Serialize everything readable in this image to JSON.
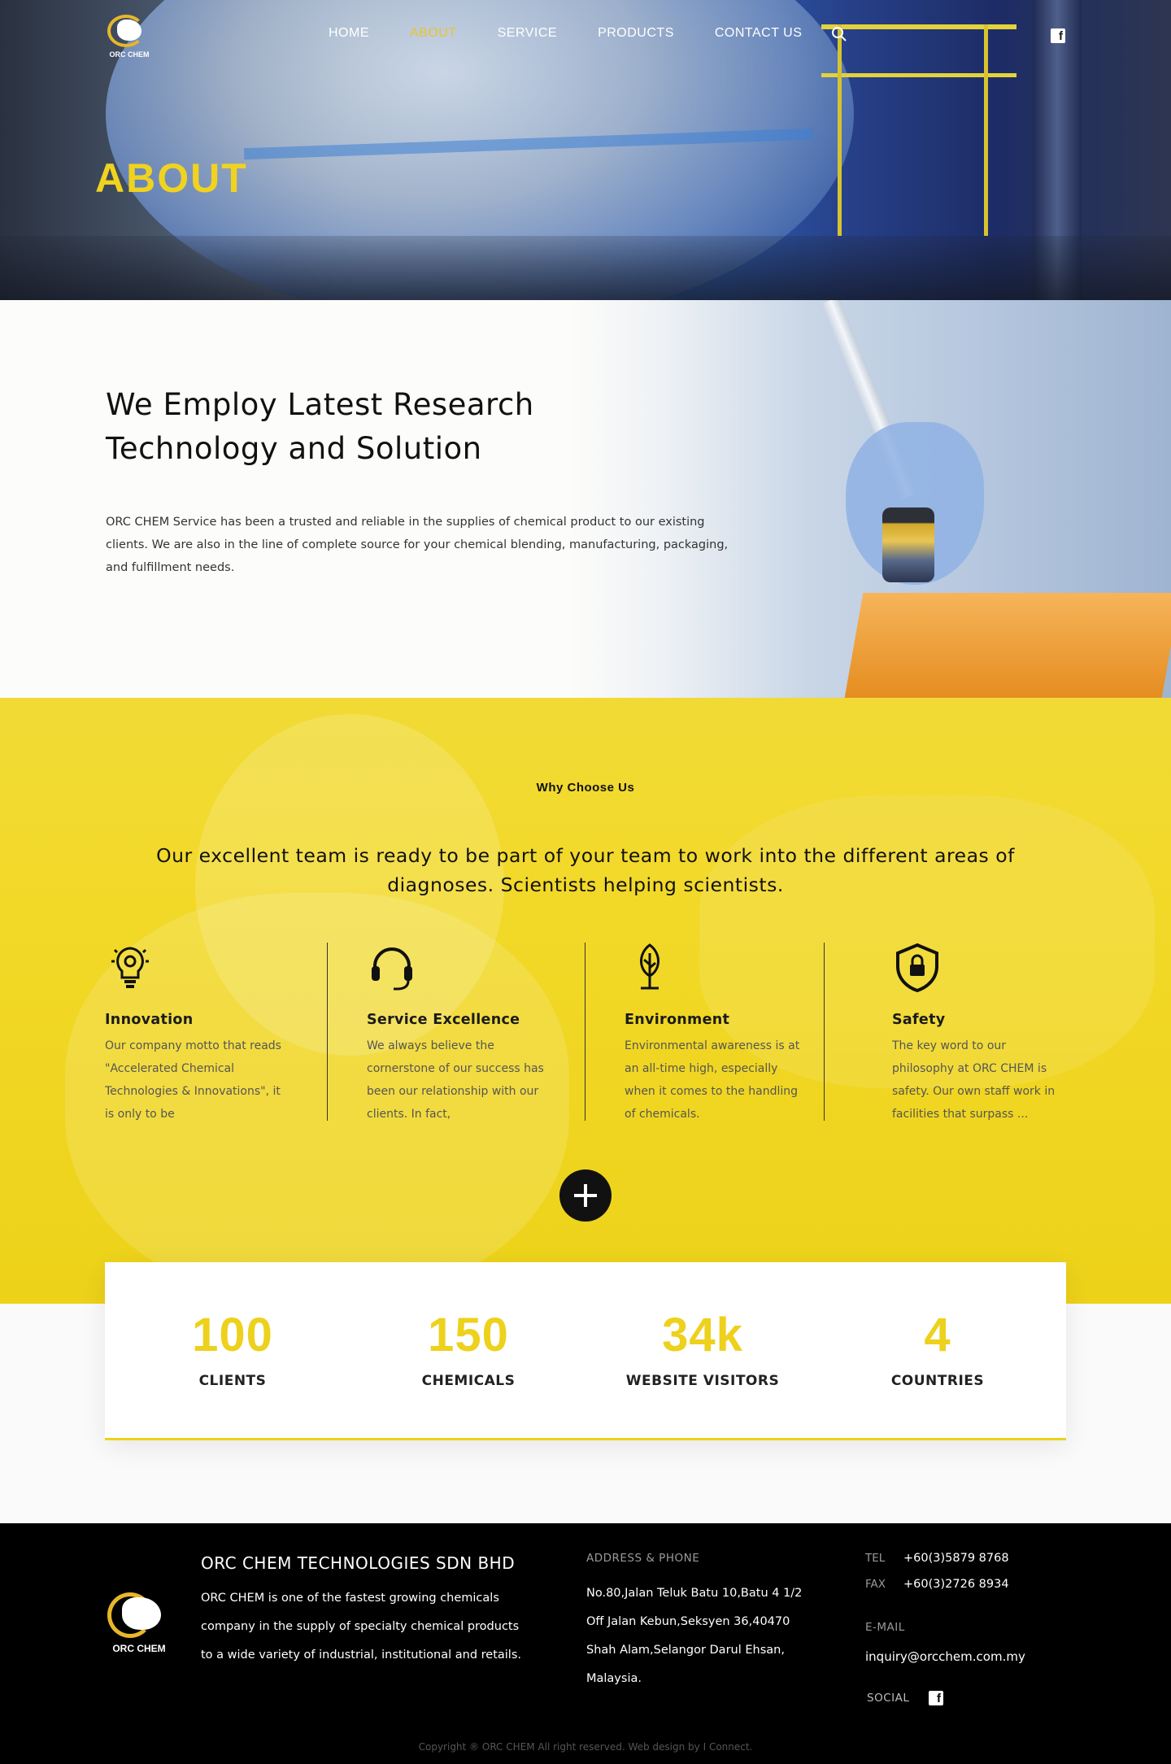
{
  "header": {
    "logo_text": "ORC CHEM",
    "nav": [
      {
        "label": "HOME"
      },
      {
        "label": "ABOUT"
      },
      {
        "label": "SERVICE"
      },
      {
        "label": "PRODUCTS"
      },
      {
        "label": "CONTACT US"
      }
    ],
    "active_nav": "ABOUT",
    "icons": [
      "search-icon",
      "facebook-icon"
    ],
    "accent_color": "#f0d31f"
  },
  "hero": {
    "title": "ABOUT"
  },
  "research": {
    "heading": "We Employ Latest Research Technology and Solution",
    "body": "ORC CHEM Service has been a trusted and reliable in the supplies of chemical product to our existing clients. We are also in the line of complete source for your chemical blending, manufacturing, packaging, and fulfillment needs."
  },
  "why": {
    "kicker": "Why Choose Us",
    "lead": "Our excellent team is ready to be part of your team to work into the different areas of diagnoses. Scientists helping scientists.",
    "features": [
      {
        "icon": "lightbulb-gear-icon",
        "title": "Innovation",
        "text": "Our company motto that reads \"Accelerated Chemical Technologies & Innovations\", it is only to be"
      },
      {
        "icon": "headset-icon",
        "title": "Service Excellence",
        "text": "We always believe the cornerstone of our success has been our relationship with our clients. In fact,"
      },
      {
        "icon": "plant-icon",
        "title": "Environment",
        "text": "Environmental awareness is at an all-time high, especially when it comes to the handling of chemicals."
      },
      {
        "icon": "shield-lock-icon",
        "title": "Safety",
        "text": "The key word to our philosophy at ORC CHEM is safety. Our own staff work in facilities that surpass ..."
      }
    ],
    "background_color": "#f2d928"
  },
  "stats": [
    {
      "value": "100",
      "label": "CLIENTS"
    },
    {
      "value": "150",
      "label": "CHEMICALS"
    },
    {
      "value": "34k",
      "label": "WEBSITE VISITORS"
    },
    {
      "value": "4",
      "label": "COUNTRIES"
    }
  ],
  "footer": {
    "logo_text": "ORC CHEM",
    "company": "ORC CHEM TECHNOLOGIES SDN BHD",
    "description": "ORC CHEM is one of the fastest growing chemicals company in the supply of specialty chemical products  to a wide variety of industrial, institutional and retails.",
    "address_heading": "ADDRESS & PHONE",
    "address": "No.80,Jalan Teluk Batu 10,Batu 4 1/2 Off Jalan Kebun,Seksyen 36,40470 Shah Alam,Selangor Darul Ehsan, Malaysia.",
    "tel_label": "TEL",
    "tel": "+60(3)5879 8768",
    "fax_label": "FAX",
    "fax": "+60(3)2726 8934",
    "email_heading": "E-MAIL",
    "email": "inquiry@orcchem.com.my",
    "social_label": "SOCIAL",
    "copyright": "Copyright ® ORC CHEM All right reserved. Web design by I Connect."
  }
}
